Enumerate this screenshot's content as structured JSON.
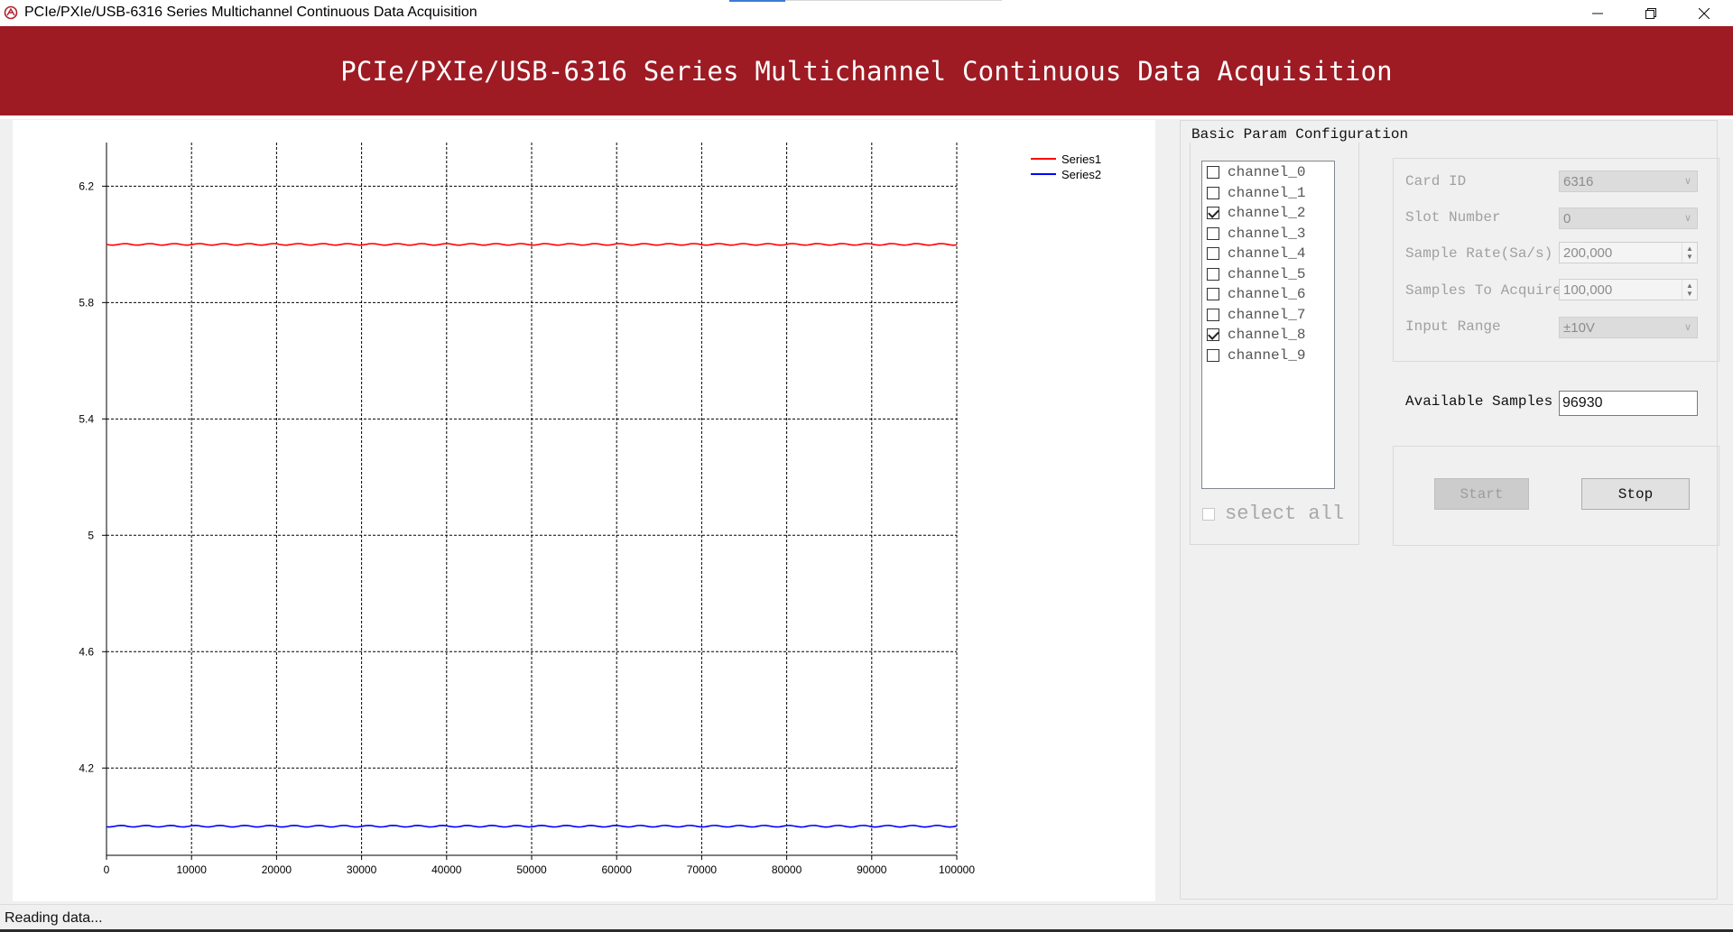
{
  "window": {
    "title": "PCIe/PXIe/USB-6316 Series Multichannel Continuous Data Acquisition",
    "controls": [
      "minimize",
      "restore",
      "close"
    ]
  },
  "banner": {
    "title": "PCIe/PXIe/USB-6316 Series Multichannel Continuous Data Acquisition",
    "color": "#9e1b24"
  },
  "config": {
    "group_title": "Basic Param Configuration",
    "channels": [
      {
        "label": "channel_0",
        "checked": false
      },
      {
        "label": "channel_1",
        "checked": false
      },
      {
        "label": "channel_2",
        "checked": true
      },
      {
        "label": "channel_3",
        "checked": false
      },
      {
        "label": "channel_4",
        "checked": false
      },
      {
        "label": "channel_5",
        "checked": false
      },
      {
        "label": "channel_6",
        "checked": false
      },
      {
        "label": "channel_7",
        "checked": false
      },
      {
        "label": "channel_8",
        "checked": true
      },
      {
        "label": "channel_9",
        "checked": false
      }
    ],
    "select_all_label": "select all",
    "card_id_label": "Card ID",
    "card_id_value": "6316",
    "slot_number_label": "Slot Number",
    "slot_number_value": "0",
    "sample_rate_label": "Sample Rate(Sa/s)",
    "sample_rate_value": "200,000",
    "samples_to_acquire_label": "Samples To Acquire",
    "samples_to_acquire_value": "100,000",
    "input_range_label": "Input Range",
    "input_range_value": "±10V",
    "available_samples_label": "Available Samples",
    "available_samples_value": "96930",
    "start_label": "Start",
    "stop_label": "Stop"
  },
  "status": {
    "text": "Reading data..."
  },
  "chart_data": {
    "type": "line",
    "title": "",
    "xlabel": "",
    "ylabel": "",
    "xlim": [
      0,
      100000
    ],
    "ylim": [
      3.9,
      6.35
    ],
    "xticks": [
      "0",
      "10000",
      "20000",
      "30000",
      "40000",
      "50000",
      "60000",
      "70000",
      "80000",
      "90000",
      "100000"
    ],
    "yticks": [
      "4.2",
      "4.6",
      "5",
      "5.4",
      "5.8",
      "6.2"
    ],
    "grid": true,
    "legend_position": "top-right",
    "x": [
      0,
      10000,
      20000,
      30000,
      40000,
      50000,
      60000,
      70000,
      80000,
      90000,
      100000
    ],
    "series": [
      {
        "name": "Series1",
        "color": "#ff0000",
        "values": [
          6.0,
          6.0,
          6.0,
          6.0,
          6.0,
          6.0,
          6.0,
          6.0,
          6.0,
          6.0,
          6.0
        ]
      },
      {
        "name": "Series2",
        "color": "#0000ff",
        "values": [
          4.0,
          4.0,
          4.0,
          4.0,
          4.0,
          4.0,
          4.0,
          4.0,
          4.0,
          4.0,
          4.0
        ]
      }
    ]
  }
}
